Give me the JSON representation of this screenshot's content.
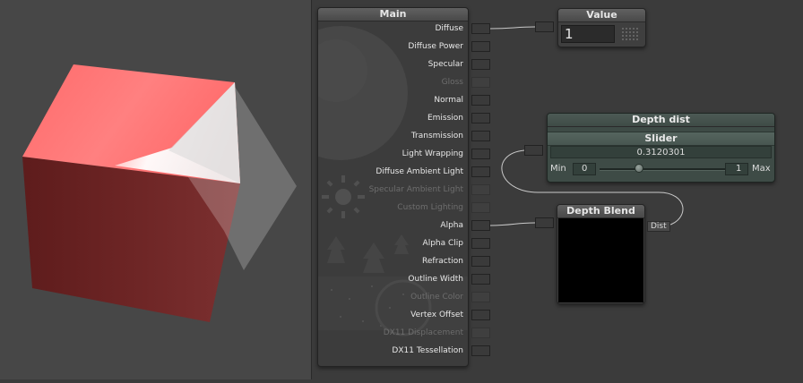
{
  "main_node": {
    "title": "Main",
    "inputs": [
      {
        "label": "Diffuse",
        "enabled": true
      },
      {
        "label": "Diffuse Power",
        "enabled": true
      },
      {
        "label": "Specular",
        "enabled": true
      },
      {
        "label": "Gloss",
        "enabled": false
      },
      {
        "label": "Normal",
        "enabled": true
      },
      {
        "label": "Emission",
        "enabled": true
      },
      {
        "label": "Transmission",
        "enabled": true
      },
      {
        "label": "Light Wrapping",
        "enabled": true
      },
      {
        "label": "Diffuse Ambient Light",
        "enabled": true
      },
      {
        "label": "Specular Ambient Light",
        "enabled": false
      },
      {
        "label": "Custom Lighting",
        "enabled": false
      },
      {
        "label": "Alpha",
        "enabled": true
      },
      {
        "label": "Alpha Clip",
        "enabled": true
      },
      {
        "label": "Refraction",
        "enabled": true
      },
      {
        "label": "Outline Width",
        "enabled": true
      },
      {
        "label": "Outline Color",
        "enabled": false
      },
      {
        "label": "Vertex Offset",
        "enabled": true
      },
      {
        "label": "DX11 Displacement",
        "enabled": false
      },
      {
        "label": "DX11 Tessellation",
        "enabled": true
      }
    ]
  },
  "value_node": {
    "title": "Value",
    "value": "1"
  },
  "depth_dist_node": {
    "title": "Depth dist",
    "subtitle": "Slider",
    "value": "0.3120301",
    "min_label": "Min",
    "min_value": "0",
    "max_label": "Max",
    "max_value": "1",
    "slider_fraction": 0.312
  },
  "depth_blend_node": {
    "title": "Depth Blend",
    "output_label": "Dist"
  },
  "colors": {
    "cube_front": "#6c2323",
    "cube_top": "#ff7575",
    "preview_background": "#000000",
    "wire": "#c9c9c9"
  }
}
